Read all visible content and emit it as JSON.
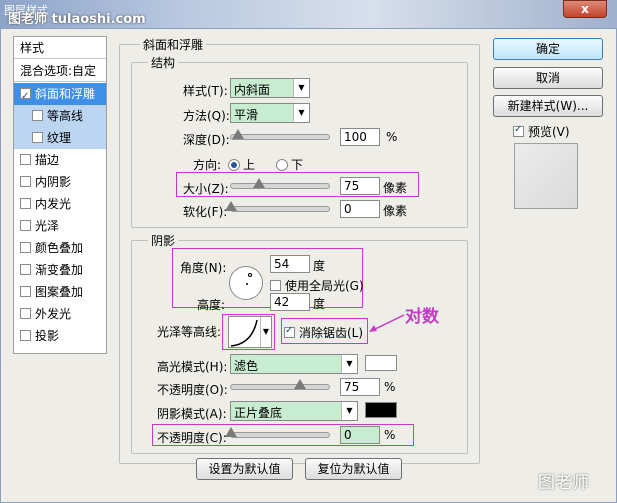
{
  "window": {
    "title": "图层样式",
    "watermark_top": "图老师 tulaoshi.com",
    "watermark_bottom": "图老师",
    "close_glyph": "x"
  },
  "left_panel": {
    "header": "样式",
    "blend_options": "混合选项:自定",
    "items": [
      {
        "label": "斜面和浮雕",
        "checked": true,
        "state": "selected"
      },
      {
        "label": "等高线",
        "checked": false,
        "state": "sub"
      },
      {
        "label": "纹理",
        "checked": false,
        "state": "sub"
      },
      {
        "label": "描边",
        "checked": false
      },
      {
        "label": "内阴影",
        "checked": false
      },
      {
        "label": "内发光",
        "checked": false
      },
      {
        "label": "光泽",
        "checked": false
      },
      {
        "label": "颜色叠加",
        "checked": false
      },
      {
        "label": "渐变叠加",
        "checked": false
      },
      {
        "label": "图案叠加",
        "checked": false
      },
      {
        "label": "外发光",
        "checked": false
      },
      {
        "label": "投影",
        "checked": false
      }
    ]
  },
  "bevel": {
    "title": "斜面和浮雕",
    "structure": {
      "title": "结构",
      "style_label": "样式(T):",
      "style_value": "内斜面",
      "technique_label": "方法(Q):",
      "technique_value": "平滑",
      "depth_label": "深度(D):",
      "depth_value": "100",
      "depth_unit": "%",
      "depth_level": 0.08,
      "direction_label": "方向:",
      "dir_up": "上",
      "dir_down": "下",
      "size_label": "大小(Z):",
      "size_value": "75",
      "size_unit": "像素",
      "size_level": 0.3,
      "soften_label": "软化(F):",
      "soften_value": "0",
      "soften_unit": "像素",
      "soften_level": 0
    },
    "shading": {
      "title": "阴影",
      "angle_label": "角度(N):",
      "angle_value": "54",
      "angle_unit": "度",
      "global_light_label": "使用全局光(G)",
      "altitude_label": "高度:",
      "altitude_value": "42",
      "altitude_unit": "度",
      "gloss_label": "光泽等高线:",
      "antialias_label": "消除锯齿(L)",
      "annotation": "对数",
      "highlight_mode_label": "高光模式(H):",
      "highlight_mode_value": "滤色",
      "highlight_color": "#ffffff",
      "highlight_opacity_label": "不透明度(O):",
      "highlight_opacity_value": "75",
      "highlight_opacity_unit": "%",
      "highlight_opacity_level": 0.75,
      "shadow_mode_label": "阴影模式(A):",
      "shadow_mode_value": "正片叠底",
      "shadow_color": "#000000",
      "shadow_opacity_label": "不透明度(C):",
      "shadow_opacity_value": "0",
      "shadow_opacity_unit": "%",
      "shadow_opacity_level": 0
    },
    "make_default": "设置为默认值",
    "reset_default": "复位为默认值"
  },
  "right_panel": {
    "ok": "确定",
    "cancel": "取消",
    "new_style": "新建样式(W)...",
    "preview_label": "预览(V)"
  },
  "colors": {
    "accent": "#c63ac6",
    "selected": "#3d8fe8",
    "select_bg": "#c8ecd0"
  }
}
